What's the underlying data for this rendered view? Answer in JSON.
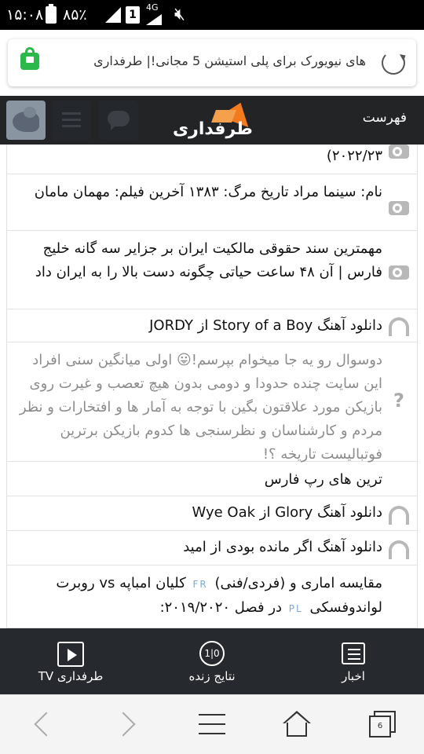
{
  "status_bar": {
    "time": "۱۵:۰۸",
    "battery": "۸۵٪",
    "sim": "1",
    "network": "4G"
  },
  "url_bar": {
    "title": "های نیویورک برای پلی استیشن 5 مجانی!| طرفداری"
  },
  "site_header": {
    "menu_label": "فهرست",
    "logo_text": "طرفداری",
    "brand_color": "#f27b1f"
  },
  "list": {
    "items": [
      {
        "text": "۲۰۲۲/۲۳)",
        "icon": "camera-icon",
        "muted": false
      },
      {
        "text": "نام: سینما مراد تاریخ مرگ: ۱۳۸۳ آخرین فیلم: مهمان مامان",
        "icon": "camera-icon",
        "muted": false
      },
      {
        "text": "مهمترین سند حقوقی مالکیت ایران بر جزایر سه گانه خلیج فارس | آن ۴۸ ساعت حیاتی چگونه دست بالا را به ایران داد",
        "icon": "camera-icon",
        "muted": false
      },
      {
        "text": "دانلود آهنگ Story of a Boy از JORDY",
        "icon": "headphones-icon",
        "muted": false
      },
      {
        "text": "دوسوال رو یه جا میخوام بپرسم!😛 اولی میانگین سنی افراد این سایت چنده حدودا و دومی بدون هیچ تعصب و غیرت روی بازیکن مورد علاقتون بگین با توجه به آمار ها و افتخارات و نظر مردم و کارشناسان و نظرسنجی ها کدوم بازیکن برترین فوتبالیست تاریخه ؟!",
        "icon": "question-icon",
        "muted": true
      },
      {
        "text": "ترین های رپ فارس",
        "icon": "",
        "muted": false
      },
      {
        "text": "دانلود آهنگ Glory از Wye Oak",
        "icon": "headphones-icon",
        "muted": false
      },
      {
        "text": "دانلود آهنگ اگر مانده بودی از امید",
        "icon": "headphones-icon",
        "muted": false
      },
      {
        "text_a": "مقایسه اماری و (فردی/فنی)",
        "tag_a": "FR",
        "text_b": "کلیان امباپه vs روبرت لواندوفسکی",
        "tag_b": "PL",
        "text_c": "در فصل ۲۰۱۹/۲۰۲۰:",
        "icon": "",
        "muted": false
      }
    ]
  },
  "bottom_nav": {
    "news": "اخبار",
    "live": "نتایج زنده",
    "live_icon_text": "1|0",
    "tv": "طرفداری TV"
  },
  "browser_bar": {
    "tab_count": "6"
  }
}
